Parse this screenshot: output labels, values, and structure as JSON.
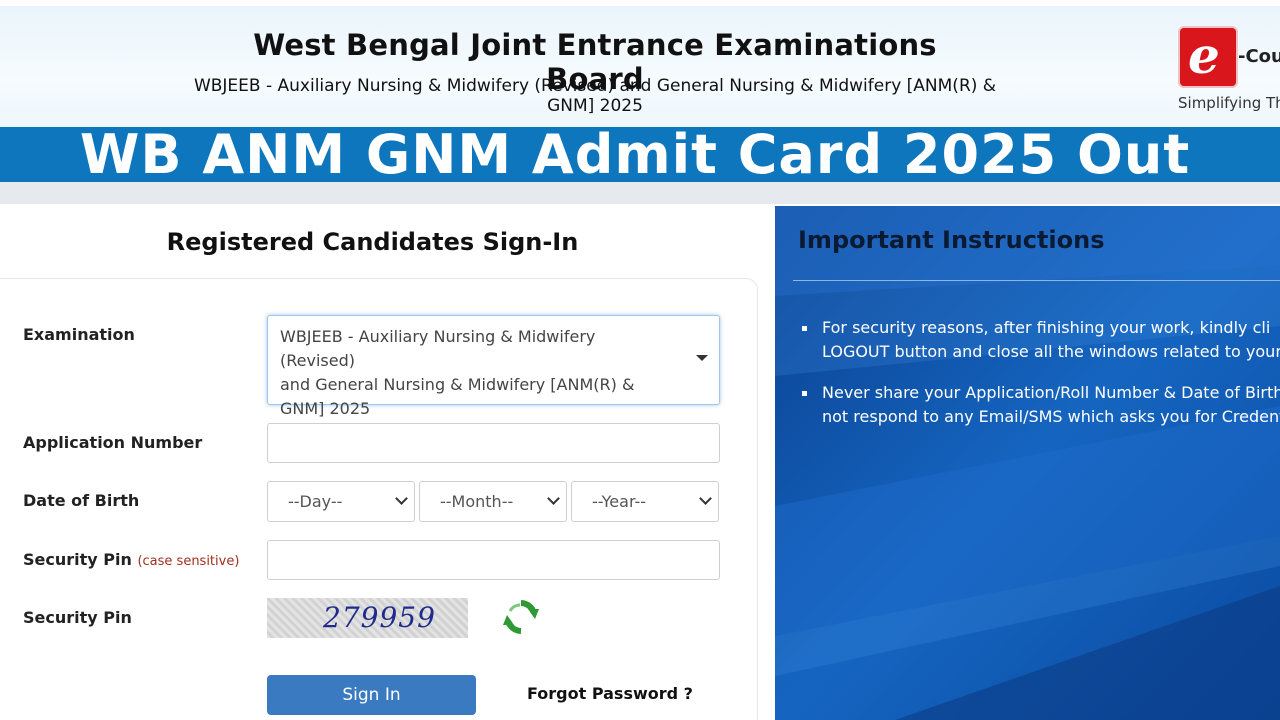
{
  "header": {
    "title": "West Bengal Joint Entrance Examinations Board",
    "subtitle_line1": "WBJEEB - Auxiliary Nursing & Midwifery (Revised) and General Nursing & Midwifery [ANM(R) &",
    "subtitle_line2": "GNM] 2025",
    "logo_letter": "e",
    "logo_word": "-Cou",
    "logo_tagline": "Simplifying Th"
  },
  "banner": {
    "text": "WB ANM GNM Admit Card 2025 Out"
  },
  "signin": {
    "title": "Registered Candidates Sign-In",
    "examination_label": "Examination",
    "examination_value_lines": [
      "WBJEEB - Auxiliary Nursing & Midwifery (Revised)",
      "and General Nursing & Midwifery [ANM(R) &",
      "GNM] 2025"
    ],
    "application_label": "Application Number",
    "application_value": "",
    "dob_label": "Date of Birth",
    "dob_day": "--Day--",
    "dob_month": "--Month--",
    "dob_year": "--Year--",
    "pin_label": "Security Pin",
    "pin_hint": "(case sensitive)",
    "pin_value": "",
    "captcha_label": "Security Pin",
    "captcha_text": "279959",
    "signin_button": "Sign In",
    "forgot_password": "Forgot Password ?"
  },
  "instructions": {
    "title": "Important Instructions",
    "items": [
      {
        "line1": "For  security  reasons,  after  finishing  your  work,  kindly  cli",
        "line2": "LOGOUT button and close all the windows related to your se"
      },
      {
        "line1": "Never share your Application/Roll Number & Date of Birth a",
        "line2": "not respond to any Email/SMS which asks you for Credentia"
      }
    ]
  },
  "colors": {
    "banner": "#0d76bd",
    "panel": "#0a4da0",
    "button": "#3a7ac0",
    "logo_red": "#d8161c"
  },
  "icons": {
    "refresh": "refresh-icon",
    "dropdown": "chevron-down-icon"
  }
}
